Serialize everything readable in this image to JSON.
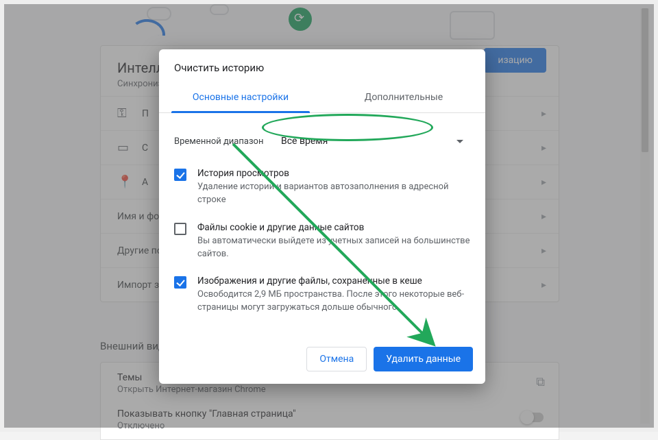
{
  "background": {
    "heading_truncated": "Интелле",
    "subheading_truncated": "Синхрониз",
    "sync_button_truncated": "изацию",
    "rows": {
      "passwords": "П",
      "payments": "С",
      "addresses": "А",
      "name_photo": "Имя и фото",
      "other": "Другие по",
      "import": "Импорт за"
    },
    "appearance_heading": "Внешний вид",
    "themes": {
      "title": "Темы",
      "subtitle": "Открыть Интернет-магазин Chrome"
    },
    "home": {
      "title": "Показывать кнопку \"Главная страница\"",
      "subtitle": "Отключено"
    }
  },
  "modal": {
    "title": "Очистить историю",
    "tabs": {
      "basic": "Основные настройки",
      "advanced": "Дополнительные"
    },
    "range": {
      "label": "Временной диапазон",
      "value": "Все время"
    },
    "options": {
      "history": {
        "title": "История просмотров",
        "desc": "Удаление истории и вариантов автозаполнения в адресной строке",
        "checked": true
      },
      "cookies": {
        "title": "Файлы cookie и другие данные сайтов",
        "desc": "Вы автоматически выйдете из учетных записей на большинстве сайтов.",
        "checked": false
      },
      "cache": {
        "title": "Изображения и другие файлы, сохраненные в кеше",
        "desc": "Освободится 2,9 МБ пространства. После этого некоторые веб-страницы могут загружаться дольше обычного.",
        "checked": true
      }
    },
    "buttons": {
      "cancel": "Отмена",
      "confirm": "Удалить данные"
    }
  }
}
